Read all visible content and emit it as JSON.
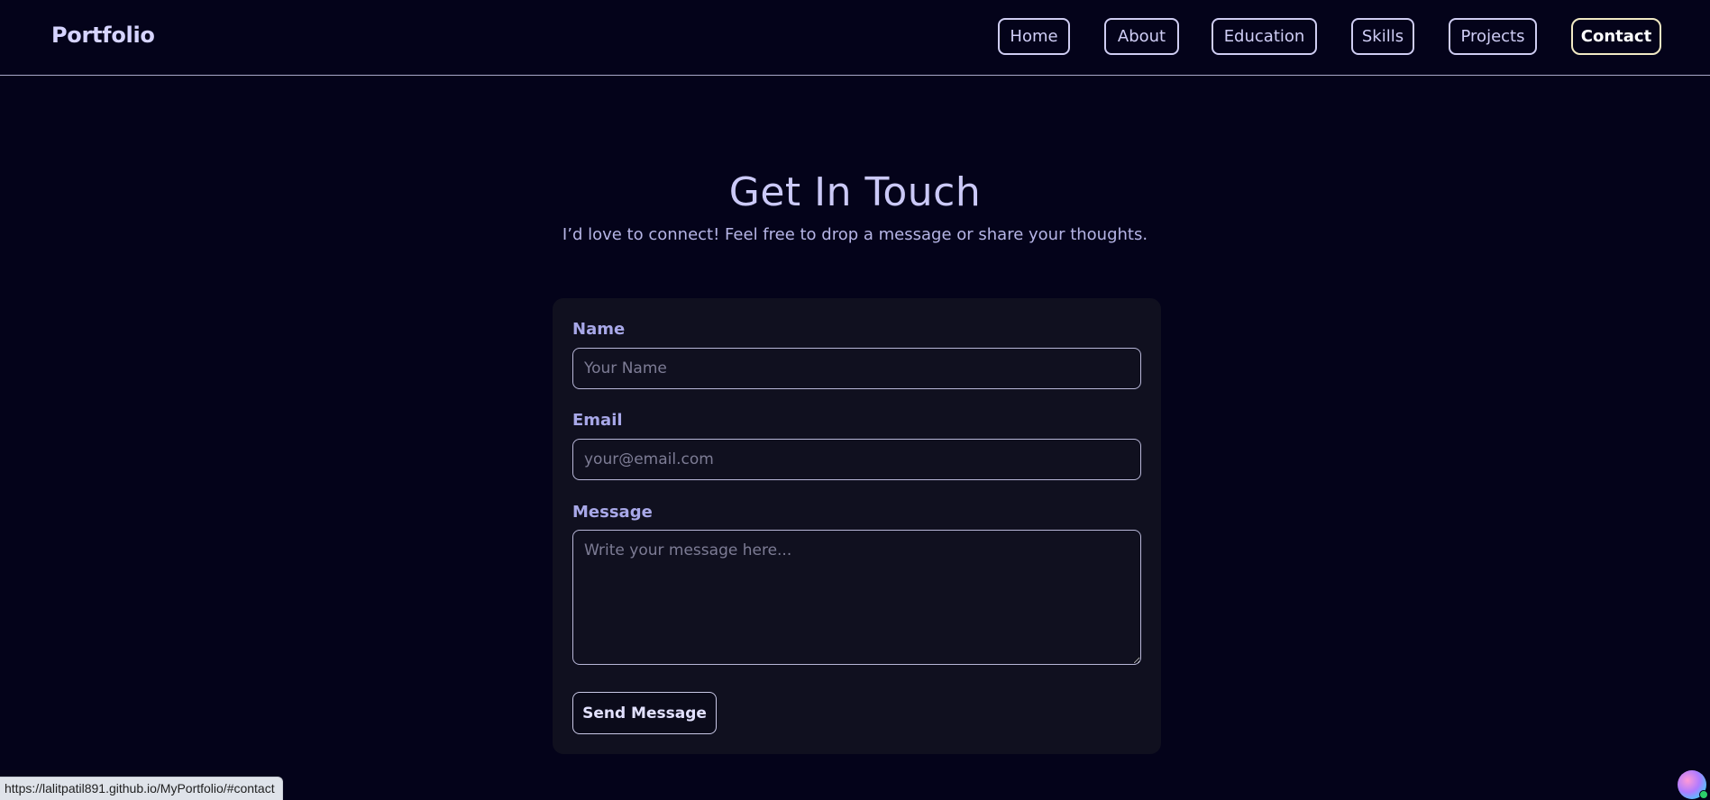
{
  "brand": "Portfolio",
  "nav": {
    "items": [
      {
        "label": "Home"
      },
      {
        "label": "About"
      },
      {
        "label": "Education"
      },
      {
        "label": "Skills"
      },
      {
        "label": "Projects"
      },
      {
        "label": "Contact"
      }
    ],
    "active": "Contact"
  },
  "contact": {
    "title": "Get In Touch",
    "subtitle": "I’d love to connect! Feel free to drop a message or share your thoughts.",
    "name_label": "Name",
    "name_placeholder": "Your Name",
    "name_value": "",
    "email_label": "Email",
    "email_placeholder": "your@email.com",
    "email_value": "",
    "message_label": "Message",
    "message_placeholder": "Write your message here...",
    "message_value": "",
    "send_label": "Send Message"
  },
  "status_bar": {
    "url": "https://lalitpatil891.github.io/MyPortfolio/#contact"
  },
  "colors": {
    "background": "#04031a",
    "card": "#10101f",
    "accent": "#cbc9f7",
    "active_border": "#f1e9c4"
  },
  "icons": {
    "avatar": "profile-avatar-icon"
  }
}
